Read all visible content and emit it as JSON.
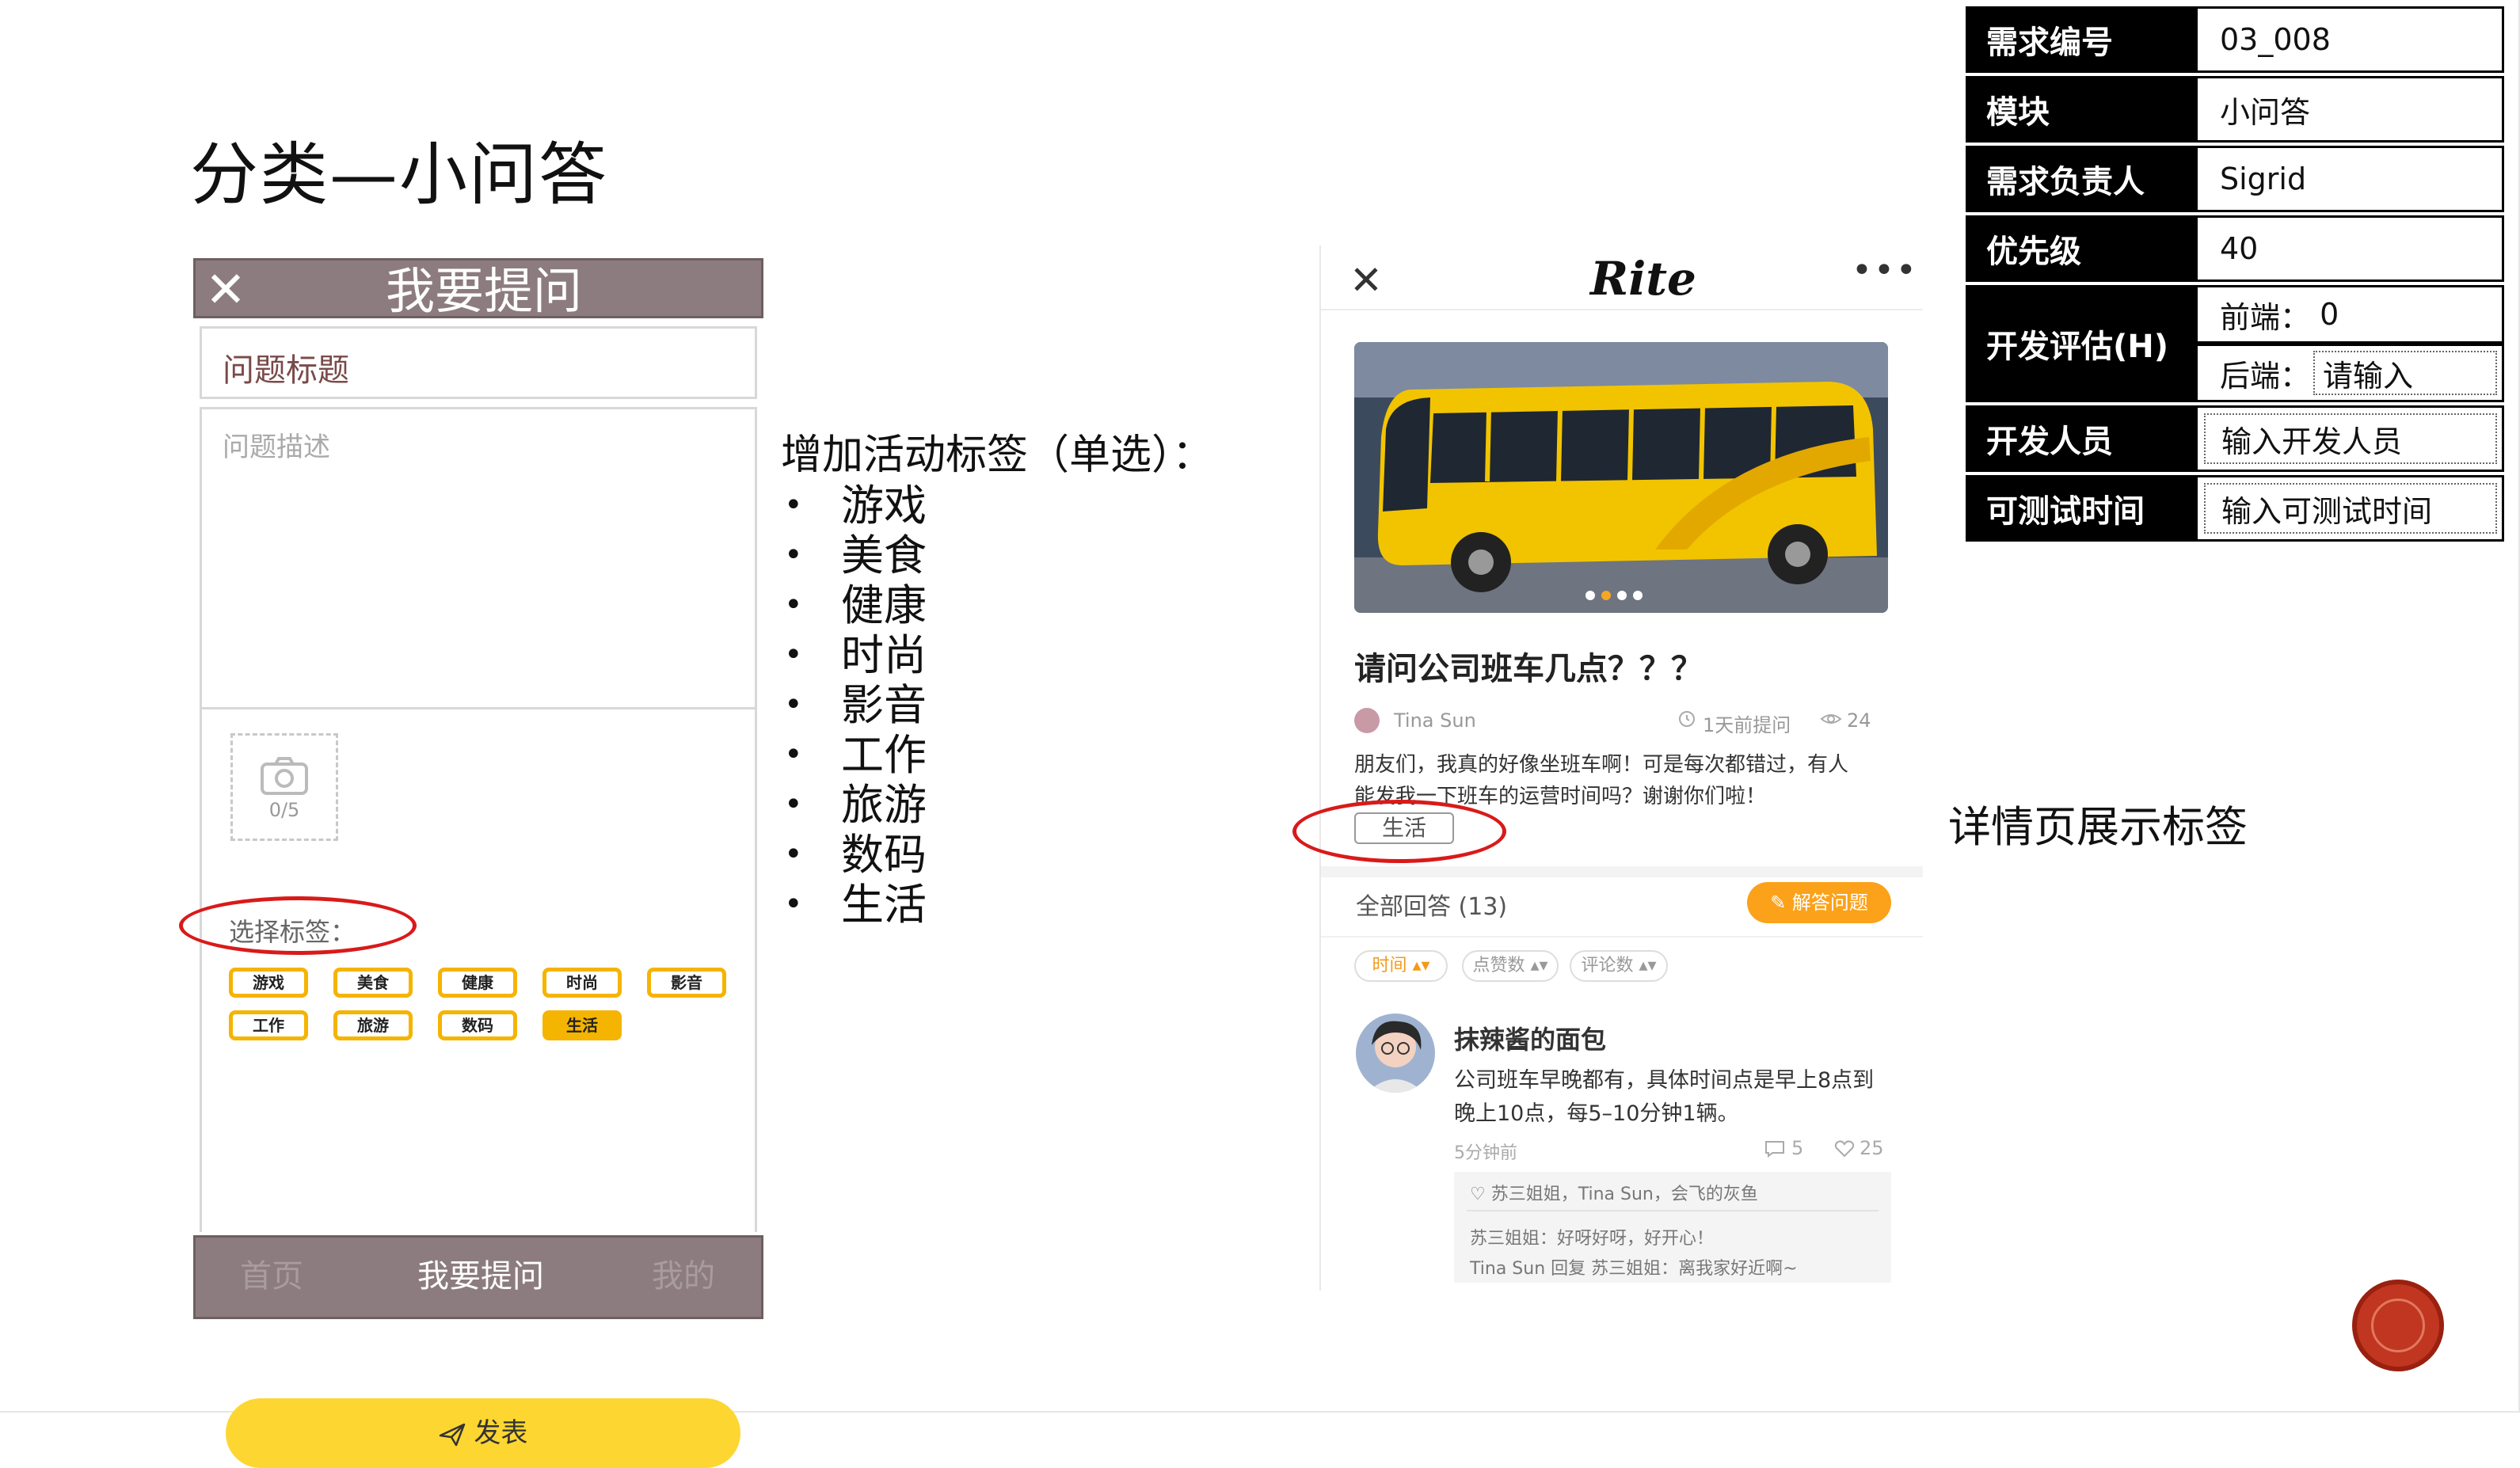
{
  "slide": {
    "title": "分类—小问答",
    "side_label": "详情页展示标签"
  },
  "ask_form": {
    "header_close": "✕",
    "header_title": "我要提问",
    "title_placeholder": "问题标题",
    "desc_placeholder": "问题描述",
    "upload_count": "0/5",
    "tag_label": "选择标签：",
    "tags": [
      {
        "label": "游戏",
        "selected": false
      },
      {
        "label": "美食",
        "selected": false
      },
      {
        "label": "健康",
        "selected": false
      },
      {
        "label": "时尚",
        "selected": false
      },
      {
        "label": "影音",
        "selected": false
      },
      {
        "label": "工作",
        "selected": false
      },
      {
        "label": "旅游",
        "selected": false
      },
      {
        "label": "数码",
        "selected": false
      },
      {
        "label": "生活",
        "selected": true
      }
    ],
    "submit_label": "发表",
    "footer": {
      "home": "首页",
      "ask": "我要提问",
      "mine": "我的"
    }
  },
  "tag_list": {
    "heading": "增加活动标签（单选）：",
    "items": [
      "游戏",
      "美食",
      "健康",
      "时尚",
      "影音",
      "工作",
      "旅游",
      "数码",
      "生活"
    ]
  },
  "detail_page": {
    "logo": "Rite",
    "question_title": "请问公司班车几点？？？",
    "author": "Tina Sun",
    "time_ago": "1天前提问",
    "views": "24",
    "body_line1": "朋友们，我真的好像坐班车啊！可是每次都错过，有人",
    "body_line2": "能发我一下班车的运营时间吗？谢谢你们啦！",
    "tag": "生活",
    "all_answers": "全部回答 (13)",
    "answer_button": "解答问题",
    "sort_options": [
      "时间",
      "点赞数",
      "评论数"
    ],
    "answer": {
      "name": "抹辣酱的面包",
      "body_line1": "公司班车早晚都有，具体时间点是早上8点到",
      "body_line2": "晚上10点，每5–10分钟1辆。",
      "time": "5分钟前",
      "comments": "5",
      "likes": "25",
      "liked_by": "苏三姐姐，Tina Sun，会飞的灰鱼",
      "reply1": "苏三姐姐：好呀好呀，好开心！",
      "reply2": "Tina Sun 回复 苏三姐姐：离我家好近啊~"
    }
  },
  "requirements": {
    "rows": [
      {
        "key": "需求编号",
        "value": "03_008"
      },
      {
        "key": "模块",
        "value": "小问答"
      },
      {
        "key": "需求负责人",
        "value": "Sigrid"
      },
      {
        "key": "优先级",
        "value": "40"
      }
    ],
    "dev_estimate": {
      "key": "开发评估(H)",
      "frontend_label": "前端：",
      "frontend_value": "0",
      "backend_label": "后端：",
      "backend_placeholder": "请输入"
    },
    "developer": {
      "key": "开发人员",
      "placeholder": "输入开发人员"
    },
    "test_time": {
      "key": "可测试时间",
      "placeholder": "输入可测试时间"
    }
  },
  "colors": {
    "header_brown": "#8c7c7f",
    "tag_yellow": "#f5b400",
    "submit_yellow": "#fdd631",
    "answer_orange": "#fba21a",
    "highlight_red": "#d91a1a"
  }
}
